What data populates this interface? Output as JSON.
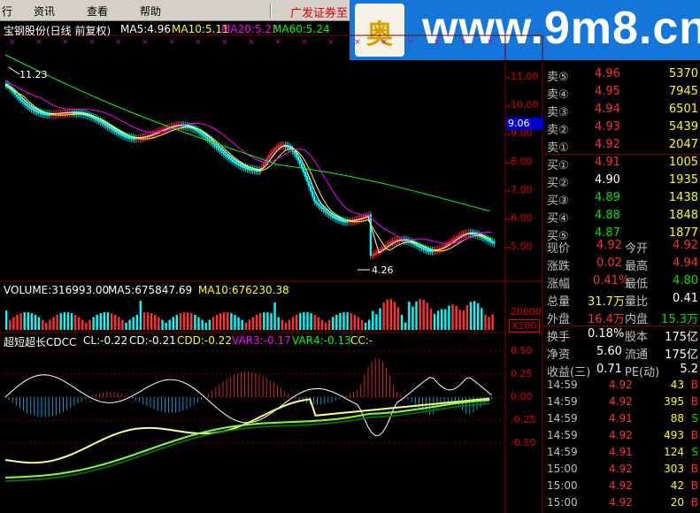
{
  "menu": {
    "items": [
      {
        "label": "行"
      },
      {
        "label": "资讯"
      },
      {
        "label": "查看"
      },
      {
        "label": "帮助"
      }
    ],
    "broker_text": "广发证券至"
  },
  "watermark": {
    "logo_char": "奥",
    "site": "www.9m8.cn",
    "icon": "coin-logo-icon"
  },
  "price_chart": {
    "title": "宝钢股份(日线 前复权)",
    "ma5": "MA5:4.96",
    "ma10": "MA10:5.11",
    "ma20": "MA20:5.23",
    "ma60": "MA60:5.24",
    "high_label": "11.23",
    "low_label": "4.26",
    "current_price": "9.06",
    "y_ticks": [
      "11.00",
      "10.00",
      "9.00",
      "8.00",
      "7.00",
      "6.00",
      "5.00"
    ],
    "colors": {
      "ma5": "#ffffff",
      "ma10": "#ffff00",
      "ma20": "#ff00ff",
      "ma60": "#00ff00",
      "up": "#ff3030",
      "down": "#00ffff"
    }
  },
  "volume_chart": {
    "title": "VOLUME:316993.00",
    "ma5": "MA5:675847.69",
    "ma10": "MA10:676230.38",
    "y_tick": "20000",
    "unit": "X100"
  },
  "indicator_chart": {
    "title": "超短超长CDCC",
    "cl": "CL:-0.22",
    "cd": "CD:-0.21",
    "cdd": "CDD:-0.22",
    "var3": "VAR3:-0.17",
    "var4": "VAR4:-0.13",
    "cc": "CC:-",
    "y_ticks": [
      "0.50",
      "0.25",
      "0.00",
      "-0.25",
      "-0.50"
    ]
  },
  "order_book": {
    "sell": [
      {
        "label": "卖⑤",
        "price": "4.96",
        "volume": "5370"
      },
      {
        "label": "卖④",
        "price": "4.95",
        "volume": "7945"
      },
      {
        "label": "卖③",
        "price": "4.94",
        "volume": "6501"
      },
      {
        "label": "卖②",
        "price": "4.93",
        "volume": "5439"
      },
      {
        "label": "卖①",
        "price": "4.92",
        "volume": "2047"
      }
    ],
    "buy": [
      {
        "label": "买①",
        "price": "4.91",
        "volume": "1005"
      },
      {
        "label": "买②",
        "price": "4.90",
        "volume": "1935"
      },
      {
        "label": "买③",
        "price": "4.89",
        "volume": "1438"
      },
      {
        "label": "买④",
        "price": "4.88",
        "volume": "1848"
      },
      {
        "label": "买⑤",
        "price": "4.87",
        "volume": "1877"
      }
    ]
  },
  "quote_stats": [
    {
      "l1": "现价",
      "v1": "4.92",
      "l2": "今开",
      "v2": "4.92"
    },
    {
      "l1": "涨跌",
      "v1": "0.02",
      "l2": "最高",
      "v2": "4.94"
    },
    {
      "l1": "涨幅",
      "v1": "0.41%",
      "l2": "最低",
      "v2": "4.80"
    },
    {
      "l1": "总量",
      "v1": "31.7万",
      "l2": "量比",
      "v2": "0.41"
    },
    {
      "l1": "外盘",
      "v1": "16.4万",
      "l2": "内盘",
      "v2": "15.3万"
    },
    {
      "l1": "换手",
      "v1": "0.18%",
      "l2": "股本",
      "v2": "175亿"
    },
    {
      "l1": "净资",
      "v1": "5.60",
      "l2": "流通",
      "v2": "175亿"
    },
    {
      "l1": "收益(三)",
      "v1": "0.71",
      "l2": "PE(动)",
      "v2": "5.2"
    }
  ],
  "ticks": [
    {
      "time": "14:59",
      "price": "4.92",
      "vol": "43",
      "dir": "B"
    },
    {
      "time": "14:59",
      "price": "4.92",
      "vol": "395",
      "dir": "B"
    },
    {
      "time": "14:59",
      "price": "4.91",
      "vol": "88",
      "dir": "S"
    },
    {
      "time": "14:59",
      "price": "4.92",
      "vol": "493",
      "dir": "B"
    },
    {
      "time": "14:59",
      "price": "4.91",
      "vol": "124",
      "dir": "S"
    },
    {
      "time": "15:00",
      "price": "4.92",
      "vol": "303",
      "dir": "B"
    },
    {
      "time": "15:00",
      "price": "4.92",
      "vol": "42",
      "dir": "B"
    },
    {
      "time": "15:00",
      "price": "4.92",
      "vol": "20",
      "dir": "B"
    }
  ]
}
